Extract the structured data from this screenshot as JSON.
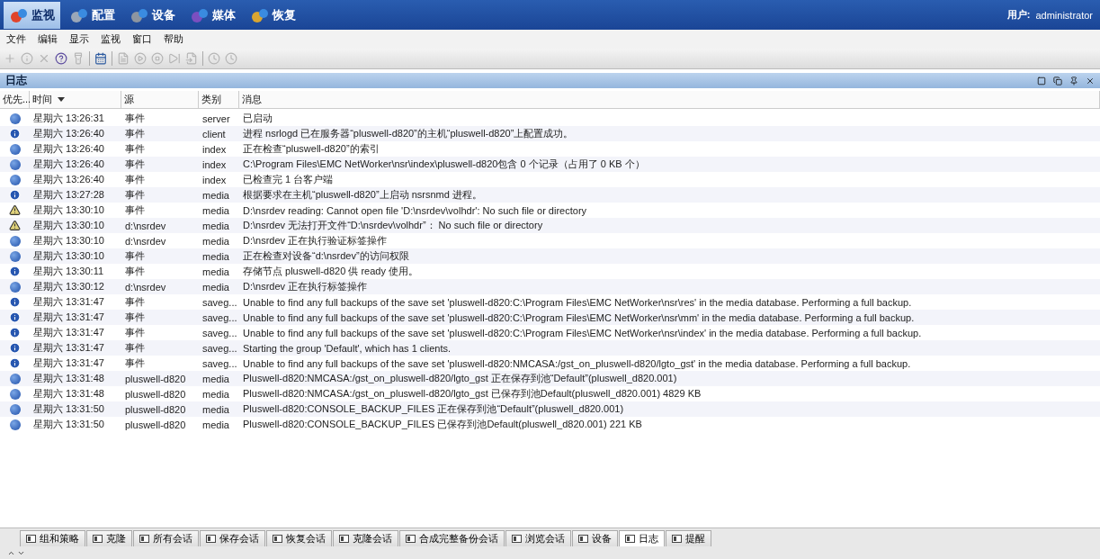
{
  "nav": [
    {
      "label": "监视",
      "selected": true
    },
    {
      "label": "配置",
      "selected": false
    },
    {
      "label": "设备",
      "selected": false
    },
    {
      "label": "媒体",
      "selected": false
    },
    {
      "label": "恢复",
      "selected": false
    }
  ],
  "user": {
    "label": "用户:",
    "value": "administrator"
  },
  "menu": [
    "文件",
    "编辑",
    "显示",
    "监视",
    "窗口",
    "帮助"
  ],
  "panel": {
    "title": "日志"
  },
  "table": {
    "columns": [
      {
        "label": "优先..."
      },
      {
        "label": "时间",
        "sorted": true
      },
      {
        "label": "源"
      },
      {
        "label": "类别"
      },
      {
        "label": "消息"
      }
    ],
    "rows": [
      {
        "kind": "dot",
        "time": "星期六 13:26:31",
        "source": "事件",
        "category": "server",
        "message": "已启动"
      },
      {
        "kind": "info",
        "time": "星期六 13:26:40",
        "source": "事件",
        "category": "client",
        "message": "进程 nsrlogd 已在服务器“pluswell-d820”的主机“pluswell-d820”上配置成功。"
      },
      {
        "kind": "dot",
        "time": "星期六 13:26:40",
        "source": "事件",
        "category": "index",
        "message": "正在检查“pluswell-d820”的索引"
      },
      {
        "kind": "dot",
        "time": "星期六 13:26:40",
        "source": "事件",
        "category": "index",
        "message": "C:\\Program Files\\EMC NetWorker\\nsr\\index\\pluswell-d820包含 0 个记录（占用了 0 KB 个）"
      },
      {
        "kind": "dot",
        "time": "星期六 13:26:40",
        "source": "事件",
        "category": "index",
        "message": "已检查完 1 台客户端"
      },
      {
        "kind": "info",
        "time": "星期六 13:27:28",
        "source": "事件",
        "category": "media",
        "message": "根据要求在主机“pluswell-d820”上启动 nsrsnmd 进程。"
      },
      {
        "kind": "warning",
        "time": "星期六 13:30:10",
        "source": "事件",
        "category": "media",
        "message": "D:\\nsrdev reading: Cannot open file 'D:\\nsrdev\\volhdr': No such file or directory"
      },
      {
        "kind": "warning",
        "time": "星期六 13:30:10",
        "source": "d:\\nsrdev",
        "category": "media",
        "message": "D:\\nsrdev 无法打开文件“D:\\nsrdev\\volhdr”： No such file or directory"
      },
      {
        "kind": "dot",
        "time": "星期六 13:30:10",
        "source": "d:\\nsrdev",
        "category": "media",
        "message": "D:\\nsrdev 正在执行验证标签操作"
      },
      {
        "kind": "dot",
        "time": "星期六 13:30:10",
        "source": "事件",
        "category": "media",
        "message": "正在检查对设备“d:\\nsrdev”的访问权限"
      },
      {
        "kind": "info",
        "time": "星期六 13:30:11",
        "source": "事件",
        "category": "media",
        "message": "存储节点 pluswell-d820 供 ready 使用。"
      },
      {
        "kind": "dot",
        "time": "星期六 13:30:12",
        "source": "d:\\nsrdev",
        "category": "media",
        "message": "D:\\nsrdev 正在执行标签操作"
      },
      {
        "kind": "info",
        "time": "星期六 13:31:47",
        "source": "事件",
        "category": "saveg...",
        "message": "Unable to find any full backups of the save set 'pluswell-d820:C:\\Program Files\\EMC NetWorker\\nsr\\res' in the media database. Performing a full backup."
      },
      {
        "kind": "info",
        "time": "星期六 13:31:47",
        "source": "事件",
        "category": "saveg...",
        "message": "Unable to find any full backups of the save set 'pluswell-d820:C:\\Program Files\\EMC NetWorker\\nsr\\mm' in the media database. Performing a full backup."
      },
      {
        "kind": "info",
        "time": "星期六 13:31:47",
        "source": "事件",
        "category": "saveg...",
        "message": "Unable to find any full backups of the save set 'pluswell-d820:C:\\Program Files\\EMC NetWorker\\nsr\\index' in the media database. Performing a full backup."
      },
      {
        "kind": "info",
        "time": "星期六 13:31:47",
        "source": "事件",
        "category": "saveg...",
        "message": "Starting the group 'Default', which has 1 clients."
      },
      {
        "kind": "info",
        "time": "星期六 13:31:47",
        "source": "事件",
        "category": "saveg...",
        "message": "Unable to find any full backups of the save set 'pluswell-d820:NMCASA:/gst_on_pluswell-d820/lgto_gst' in the media database. Performing a full backup."
      },
      {
        "kind": "dot",
        "time": "星期六 13:31:48",
        "source": "pluswell-d820",
        "category": "media",
        "message": "Pluswell-d820:NMCASA:/gst_on_pluswell-d820/lgto_gst 正在保存到池“Default”(pluswell_d820.001)"
      },
      {
        "kind": "dot",
        "time": "星期六 13:31:48",
        "source": "pluswell-d820",
        "category": "media",
        "message": "Pluswell-d820:NMCASA:/gst_on_pluswell-d820/lgto_gst 已保存到池Default(pluswell_d820.001) 4829 KB"
      },
      {
        "kind": "dot",
        "time": "星期六 13:31:50",
        "source": "pluswell-d820",
        "category": "media",
        "message": "Pluswell-d820:CONSOLE_BACKUP_FILES 正在保存到池“Default”(pluswell_d820.001)"
      },
      {
        "kind": "dot",
        "time": "星期六 13:31:50",
        "source": "pluswell-d820",
        "category": "media",
        "message": "Pluswell-d820:CONSOLE_BACKUP_FILES 已保存到池Default(pluswell_d820.001) 221 KB"
      }
    ]
  },
  "bottom_tabs": [
    {
      "label": "组和策略",
      "selected": false
    },
    {
      "label": "克隆",
      "selected": false
    },
    {
      "label": "所有会话",
      "selected": false
    },
    {
      "label": "保存会话",
      "selected": false
    },
    {
      "label": "恢复会话",
      "selected": false
    },
    {
      "label": "克隆会话",
      "selected": false
    },
    {
      "label": "合成完整备份会话",
      "selected": false
    },
    {
      "label": "浏览会话",
      "selected": false
    },
    {
      "label": "设备",
      "selected": false
    },
    {
      "label": "日志",
      "selected": true
    },
    {
      "label": "提醒",
      "selected": false
    }
  ]
}
